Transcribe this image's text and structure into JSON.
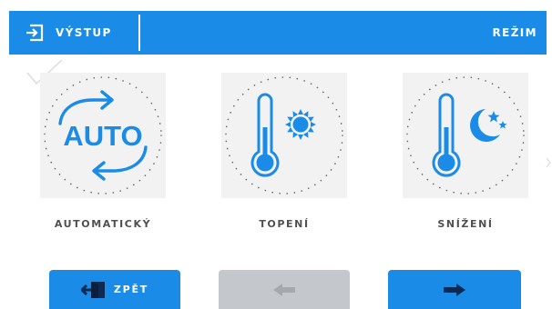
{
  "header": {
    "exit_label": "VÝSTUP",
    "mode_label": "REŽIM",
    "exit_icon": "exit-door-icon"
  },
  "modes": [
    {
      "label": "AUTOMATICKÝ",
      "icon": "auto-cycle-icon",
      "icon_text": "AUTO"
    },
    {
      "label": "TOPENÍ",
      "icon": "thermometer-sun-icon"
    },
    {
      "label": "SNÍŽENÍ",
      "icon": "thermometer-moon-icon"
    }
  ],
  "footer": {
    "back_label": "ZPĚT",
    "back_icon": "exit-door-icon",
    "prev_icon": "arrow-left-icon",
    "next_icon": "arrow-right-icon"
  },
  "colors": {
    "accent": "#1a8ce8",
    "tile_bg": "#f2f2f2",
    "disabled": "#c4c7cc",
    "label_text": "#505050"
  }
}
